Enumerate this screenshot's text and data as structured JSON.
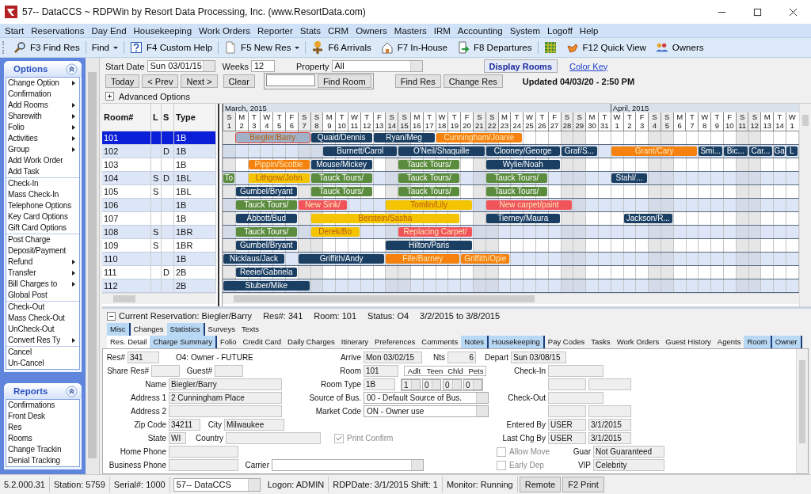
{
  "window": {
    "title": "57-- DataCCS ~ RDPWin by Resort Data Processing, Inc. (www.ResortData.com)"
  },
  "menu": [
    "Start",
    "Reservations",
    "Day End",
    "Housekeeping",
    "Work Orders",
    "Reporter",
    "Stats",
    "CRM",
    "Owners",
    "Masters",
    "IRM",
    "Accounting",
    "System",
    "Logoff",
    "Help"
  ],
  "toolbar": [
    {
      "label": "F3 Find Res",
      "dropdown": false
    },
    {
      "label": "Find",
      "dropdown": true
    },
    {
      "label": "F4 Custom Help",
      "dropdown": false
    },
    {
      "label": "F5 New Res",
      "dropdown": true
    },
    {
      "label": "F6 Arrivals",
      "dropdown": false
    },
    {
      "label": "F7 In-House",
      "dropdown": false
    },
    {
      "label": "F8 Departures",
      "dropdown": false
    },
    {
      "dropdown": false
    },
    {
      "label": "F12 Quick View",
      "dropdown": false
    },
    {
      "label": "Owners",
      "dropdown": false
    }
  ],
  "options_panel": {
    "title": "Options",
    "groups": [
      [
        {
          "label": "Change Option",
          "submenu": true
        },
        {
          "label": "Confirmation",
          "submenu": false
        },
        {
          "label": "Add Rooms",
          "submenu": true
        },
        {
          "label": "Sharewith",
          "submenu": true
        },
        {
          "label": "Folio",
          "submenu": true
        },
        {
          "label": "Activities",
          "submenu": true
        },
        {
          "label": "Group",
          "submenu": true
        },
        {
          "label": "Add Work Order",
          "submenu": false
        },
        {
          "label": "Add Task",
          "submenu": false
        }
      ],
      [
        {
          "label": "Check-In",
          "submenu": false
        },
        {
          "label": "Mass Check-In",
          "submenu": false
        },
        {
          "label": "Telephone Options",
          "submenu": false
        },
        {
          "label": "Key Card Options",
          "submenu": false
        },
        {
          "label": "Gift Card Options",
          "submenu": false
        }
      ],
      [
        {
          "label": "Post Charge",
          "submenu": false
        },
        {
          "label": "Deposit/Payment",
          "submenu": false
        },
        {
          "label": "Refund",
          "submenu": true
        },
        {
          "label": "Transfer",
          "submenu": true
        },
        {
          "label": "Bill Charges to",
          "submenu": true
        },
        {
          "label": "Global Post",
          "submenu": false
        }
      ],
      [
        {
          "label": "Check-Out",
          "submenu": false
        },
        {
          "label": "Mass Check-Out",
          "submenu": false
        },
        {
          "label": "UnCheck-Out",
          "submenu": false
        },
        {
          "label": "Convert Res Ty",
          "submenu": true
        }
      ],
      [
        {
          "label": "Cancel",
          "submenu": false
        },
        {
          "label": "Un-Cancel",
          "submenu": false
        }
      ]
    ]
  },
  "reports_panel": {
    "title": "Reports",
    "items": [
      "Confirmations",
      "Front Desk",
      "Res",
      "Rooms",
      "Change Trackin",
      "Denial Tracking"
    ]
  },
  "controls": {
    "start_date": {
      "label": "Start Date",
      "value": "Sun 03/01/15"
    },
    "weeks": {
      "label": "Weeks",
      "value": "12"
    },
    "property": {
      "label": "Property",
      "value": "All"
    },
    "display_rooms": "Display Rooms",
    "color_key": "Color Key",
    "nav_buttons": [
      "Today",
      "< Prev",
      "Next >"
    ],
    "clear": "Clear",
    "find_room": "Find Room",
    "find_res": "Find Res",
    "change_res": "Change Res",
    "updated": "Updated 04/03/20 - 2:50 PM",
    "advanced_options": "Advanced Options"
  },
  "table": {
    "columns": [
      "Room#",
      "L",
      "S",
      "Type"
    ]
  },
  "calendar": {
    "days": [
      {
        "letter": "S",
        "num": "1",
        "weekend": true,
        "month": "March, 2015"
      },
      {
        "letter": "M",
        "num": "2",
        "weekend": false
      },
      {
        "letter": "T",
        "num": "3",
        "weekend": false
      },
      {
        "letter": "W",
        "num": "4",
        "weekend": false
      },
      {
        "letter": "T",
        "num": "5",
        "weekend": false
      },
      {
        "letter": "F",
        "num": "6",
        "weekend": false
      },
      {
        "letter": "S",
        "num": "7",
        "weekend": true
      },
      {
        "letter": "S",
        "num": "8",
        "weekend": true
      },
      {
        "letter": "M",
        "num": "9",
        "weekend": false
      },
      {
        "letter": "T",
        "num": "10",
        "weekend": false
      },
      {
        "letter": "W",
        "num": "11",
        "weekend": false
      },
      {
        "letter": "T",
        "num": "12",
        "weekend": false
      },
      {
        "letter": "F",
        "num": "13",
        "weekend": false
      },
      {
        "letter": "S",
        "num": "14",
        "weekend": true
      },
      {
        "letter": "S",
        "num": "15",
        "weekend": true
      },
      {
        "letter": "M",
        "num": "16",
        "weekend": false
      },
      {
        "letter": "T",
        "num": "17",
        "weekend": false
      },
      {
        "letter": "W",
        "num": "18",
        "weekend": false
      },
      {
        "letter": "T",
        "num": "19",
        "weekend": false
      },
      {
        "letter": "F",
        "num": "20",
        "weekend": false
      },
      {
        "letter": "S",
        "num": "21",
        "weekend": true
      },
      {
        "letter": "S",
        "num": "22",
        "weekend": true
      },
      {
        "letter": "M",
        "num": "23",
        "weekend": false
      },
      {
        "letter": "T",
        "num": "24",
        "weekend": false
      },
      {
        "letter": "W",
        "num": "25",
        "weekend": false
      },
      {
        "letter": "T",
        "num": "26",
        "weekend": false
      },
      {
        "letter": "F",
        "num": "27",
        "weekend": false
      },
      {
        "letter": "S",
        "num": "28",
        "weekend": true
      },
      {
        "letter": "S",
        "num": "29",
        "weekend": true
      },
      {
        "letter": "M",
        "num": "30",
        "weekend": false
      },
      {
        "letter": "T",
        "num": "31",
        "weekend": false
      },
      {
        "letter": "W",
        "num": "1",
        "weekend": false,
        "month": "April, 2015"
      },
      {
        "letter": "T",
        "num": "2",
        "weekend": false
      },
      {
        "letter": "F",
        "num": "3",
        "weekend": false
      },
      {
        "letter": "S",
        "num": "4",
        "weekend": true
      },
      {
        "letter": "S",
        "num": "5",
        "weekend": true
      },
      {
        "letter": "M",
        "num": "6",
        "weekend": false
      },
      {
        "letter": "T",
        "num": "7",
        "weekend": false
      },
      {
        "letter": "W",
        "num": "8",
        "weekend": false
      },
      {
        "letter": "T",
        "num": "9",
        "weekend": false
      },
      {
        "letter": "F",
        "num": "10",
        "weekend": false
      },
      {
        "letter": "S",
        "num": "11",
        "weekend": true
      },
      {
        "letter": "S",
        "num": "12",
        "weekend": true
      },
      {
        "letter": "M",
        "num": "13",
        "weekend": false
      },
      {
        "letter": "T",
        "num": "14",
        "weekend": false
      },
      {
        "letter": "W",
        "num": "1",
        "weekend": false
      }
    ]
  },
  "rooms": [
    {
      "room": "101",
      "type": "1B",
      "selected": true,
      "bars": [
        {
          "label": "Biegler/Barry",
          "color": "#9fb2c7",
          "selected": true
        },
        {
          "label": "Quaid/Dennis",
          "color": "#1b3f63",
          "selected": false
        },
        {
          "label": "Ryan/Meg",
          "color": "#1b3f63",
          "selected": false
        },
        {
          "label": "Cunningham/Joanie",
          "color": "#f5820f",
          "selected": false
        }
      ]
    },
    {
      "room": "102",
      "s": "D",
      "type": "1B",
      "selected": false,
      "bars": [
        {
          "label": "Burnett/Carol",
          "color": "#1b3f63",
          "selected": false
        },
        {
          "label": "O'Neil/Shaquille",
          "color": "#1b3f63",
          "selected": false
        },
        {
          "label": "Clooney/George",
          "color": "#1b3f63",
          "selected": false
        },
        {
          "label": "Graf/S...",
          "color": "#1b3f63",
          "selected": false
        },
        {
          "label": "Grant/Cary",
          "color": "#f5820f",
          "selected": false
        },
        {
          "label": "Smi...",
          "color": "#1b3f63",
          "selected": false
        },
        {
          "label": "Bic...",
          "color": "#1b3f63",
          "selected": false
        },
        {
          "label": "Car...",
          "color": "#1b3f63",
          "selected": false
        },
        {
          "label": "Ga",
          "color": "#1b3f63",
          "selected": false
        },
        {
          "label": "L",
          "color": "#1b3f63",
          "selected": false
        }
      ]
    },
    {
      "room": "103",
      "type": "1B",
      "selected": false,
      "bars": [
        {
          "label": "Pippin/Scottie",
          "color": "#f5820f",
          "selected": false
        },
        {
          "label": "Mouse/Mickey",
          "color": "#1b3f63",
          "selected": false
        },
        {
          "label": "Tauck Tours/",
          "color": "#5b8c3e",
          "selected": false
        },
        {
          "label": "Wylie/Noah",
          "color": "#1b3f63",
          "selected": false
        }
      ]
    },
    {
      "room": "104",
      "l": "S",
      "s": "D",
      "type": "1BL",
      "selected": false,
      "bars": [
        {
          "label": "To",
          "color": "#5b8c3e",
          "selected": false
        },
        {
          "label": "Lithgow/John",
          "color": "#f5c400",
          "selected": false
        },
        {
          "label": "Tauck Tours/",
          "color": "#5b8c3e",
          "selected": false
        },
        {
          "label": "Tauck Tours/",
          "color": "#5b8c3e",
          "selected": false
        },
        {
          "label": "Tauck Tours/",
          "color": "#5b8c3e",
          "selected": false
        },
        {
          "label": "Stahl/...",
          "color": "#1b3f63",
          "selected": false
        }
      ]
    },
    {
      "room": "105",
      "l": "S",
      "type": "1BL",
      "selected": false,
      "bars": [
        {
          "label": "Gumbel/Bryant",
          "color": "#1b3f63",
          "selected": false
        },
        {
          "label": "Tauck Tours/",
          "color": "#5b8c3e",
          "selected": false
        },
        {
          "label": "Tauck Tours/",
          "color": "#5b8c3e",
          "selected": false
        },
        {
          "label": "Tauck Tours/",
          "color": "#5b8c3e",
          "selected": false
        }
      ]
    },
    {
      "room": "106",
      "type": "1B",
      "selected": false,
      "bars": [
        {
          "label": "Tauck Tours/",
          "color": "#5b8c3e",
          "selected": false
        },
        {
          "label": "New Sink/",
          "color": "#f0545a",
          "selected": false
        },
        {
          "label": "Tomlin/Lily",
          "color": "#f5c400",
          "selected": false
        },
        {
          "label": "New carpet/paint",
          "color": "#f0545a",
          "selected": false
        }
      ]
    },
    {
      "room": "107",
      "type": "1B",
      "selected": false,
      "bars": [
        {
          "label": "Abbott/Bud",
          "color": "#1b3f63",
          "selected": false
        },
        {
          "label": "Berstein/Sasha",
          "color": "#f5c400",
          "selected": false
        },
        {
          "label": "Tierney/Maura",
          "color": "#1b3f63",
          "selected": false
        },
        {
          "label": "Jackson/R...",
          "color": "#1b3f63",
          "selected": false
        }
      ]
    },
    {
      "room": "108",
      "l": "S",
      "type": "1BR",
      "selected": false,
      "bars": [
        {
          "label": "Tauck Tours/",
          "color": "#5b8c3e",
          "selected": false
        },
        {
          "label": "Derek/Bo",
          "color": "#f5c400",
          "selected": false
        },
        {
          "label": "Replacing Carpet/",
          "color": "#f0545a",
          "selected": false
        }
      ]
    },
    {
      "room": "109",
      "l": "S",
      "type": "1BR",
      "selected": false,
      "bars": [
        {
          "label": "Gumbel/Bryant",
          "color": "#1b3f63",
          "selected": false
        },
        {
          "label": "Hilton/Paris",
          "color": "#1b3f63",
          "selected": false
        }
      ]
    },
    {
      "room": "110",
      "type": "1B",
      "selected": false,
      "bars": [
        {
          "label": "Nicklaus/Jack",
          "color": "#1b3f63",
          "selected": false
        },
        {
          "label": "Griffith/Andy",
          "color": "#1b3f63",
          "selected": false
        },
        {
          "label": "Fife/Barney",
          "color": "#f5820f",
          "selected": false
        },
        {
          "label": "Griffith/Opie",
          "color": "#f5820f",
          "selected": false
        }
      ]
    },
    {
      "room": "111",
      "s": "D",
      "type": "2B",
      "selected": false,
      "bars": [
        {
          "label": "Reeie/Gabriela",
          "color": "#1b3f63",
          "selected": false
        }
      ]
    },
    {
      "room": "112",
      "type": "2B",
      "selected": false,
      "bars": [
        {
          "label": "Stuber/Mike",
          "color": "#1b3f63",
          "selected": false
        }
      ]
    }
  ],
  "detail": {
    "header": [
      "Current Reservation: Biegler/Barry",
      "Res#: 341",
      "Room: 101",
      "Status: O4",
      "3/2/2015 to 3/8/2015"
    ],
    "tab_rows": [
      [
        {
          "label": "Misc",
          "selected": false,
          "highlighted": true
        },
        {
          "label": "Changes",
          "selected": false,
          "highlighted": false
        },
        {
          "label": "Statistics",
          "selected": false,
          "highlighted": true
        },
        {
          "label": "Surveys",
          "selected": false,
          "highlighted": false
        },
        {
          "label": "Texts",
          "selected": false,
          "highlighted": false
        }
      ],
      [
        {
          "label": "Res. Detail",
          "selected": true,
          "highlighted": false
        },
        {
          "label": "Charge Summary",
          "selected": false,
          "highlighted": true
        },
        {
          "label": "Folio",
          "selected": false,
          "highlighted": false
        },
        {
          "label": "Credit Card",
          "selected": false,
          "highlighted": false
        },
        {
          "label": "Daily Charges",
          "selected": false,
          "highlighted": false
        },
        {
          "label": "Itinerary",
          "selected": false,
          "highlighted": false
        },
        {
          "label": "Preferences",
          "selected": false,
          "highlighted": false
        },
        {
          "label": "Comments",
          "selected": false,
          "highlighted": false
        },
        {
          "label": "Notes",
          "selected": false,
          "highlighted": true
        },
        {
          "label": "Housekeeping",
          "selected": false,
          "highlighted": true
        },
        {
          "label": "Pay Codes",
          "selected": false,
          "highlighted": false
        },
        {
          "label": "Tasks",
          "selected": false,
          "highlighted": false
        },
        {
          "label": "Work Orders",
          "selected": false,
          "highlighted": false
        },
        {
          "label": "Guest History",
          "selected": false,
          "highlighted": false
        },
        {
          "label": "Agents",
          "selected": false,
          "highlighted": false
        },
        {
          "label": "Room",
          "selected": false,
          "highlighted": true
        },
        {
          "label": "Owner",
          "selected": false,
          "highlighted": true
        }
      ]
    ],
    "form": {
      "res_no": {
        "label": "Res#",
        "value": "341"
      },
      "status": "O4: Owner - FUTURE",
      "share_res": {
        "label": "Share Res#"
      },
      "guest": {
        "label": "Guest#"
      },
      "name": {
        "label": "Name",
        "value": "Biegler/Barry"
      },
      "address1": {
        "label": "Address 1",
        "value": "2 Cunningham Place"
      },
      "address2": {
        "label": "Address 2"
      },
      "zip": {
        "label": "Zip Code",
        "value": "34211"
      },
      "city": {
        "label": "City",
        "value": "Milwaukee"
      },
      "state": {
        "label": "State",
        "value": "WI"
      },
      "country": {
        "label": "Country"
      },
      "home_phone": {
        "label": "Home Phone"
      },
      "business_phone": {
        "label": "Business Phone"
      },
      "carrier": {
        "label": "Carrier"
      },
      "arrive": {
        "label": "Arrive",
        "value": "Mon 03/02/15"
      },
      "nights": {
        "label": "Nts",
        "value": "6"
      },
      "depart": {
        "label": "Depart",
        "value": "Sun 03/08/15"
      },
      "room": {
        "label": "Room",
        "value": "101"
      },
      "room_type": {
        "label": "Room Type",
        "value": "1B"
      },
      "occupancy": [
        {
          "label": "Adlt",
          "value": "1"
        },
        {
          "label": "Teen",
          "value": "0"
        },
        {
          "label": "Chld",
          "value": "0"
        },
        {
          "label": "Pets",
          "value": "0"
        }
      ],
      "source": {
        "label": "Source of Bus.",
        "value": "00 - Default Source of Bus."
      },
      "market": {
        "label": "Market Code",
        "value": "ON - Owner use"
      },
      "print_confirm": {
        "label": "Print Confirm",
        "checked": true
      },
      "allow_move": {
        "label": "Allow Move",
        "checked": false
      },
      "early_dep": {
        "label": "Early Dep",
        "checked": false
      },
      "check_in": {
        "label": "Check-In"
      },
      "check_out": {
        "label": "Check-Out"
      },
      "entered_by": {
        "label": "Entered By",
        "user": "USER",
        "date": "3/1/2015"
      },
      "last_chg": {
        "label": "Last Chg By",
        "user": "USER",
        "date": "3/1/2015"
      },
      "guar": {
        "label": "Guar",
        "value": "Not Guaranteed"
      },
      "vip": {
        "label": "VIP",
        "value": "Celebrity"
      }
    }
  },
  "status_bar": [
    {
      "kind": "text",
      "text": "5.2.000.31"
    },
    {
      "kind": "text",
      "text": "Station: 5759"
    },
    {
      "kind": "text",
      "text": "Serial#: 1000"
    },
    {
      "kind": "dropdown",
      "text": "57-- DataCCS"
    },
    {
      "kind": "text",
      "text": "Logon: ADMIN"
    },
    {
      "kind": "text",
      "text": "RDPDate: 3/1/2015 Shift: 1"
    },
    {
      "kind": "text",
      "text": "Monitor: Running"
    },
    {
      "kind": "button",
      "text": "Remote"
    },
    {
      "kind": "button",
      "text": "F2 Print"
    }
  ]
}
